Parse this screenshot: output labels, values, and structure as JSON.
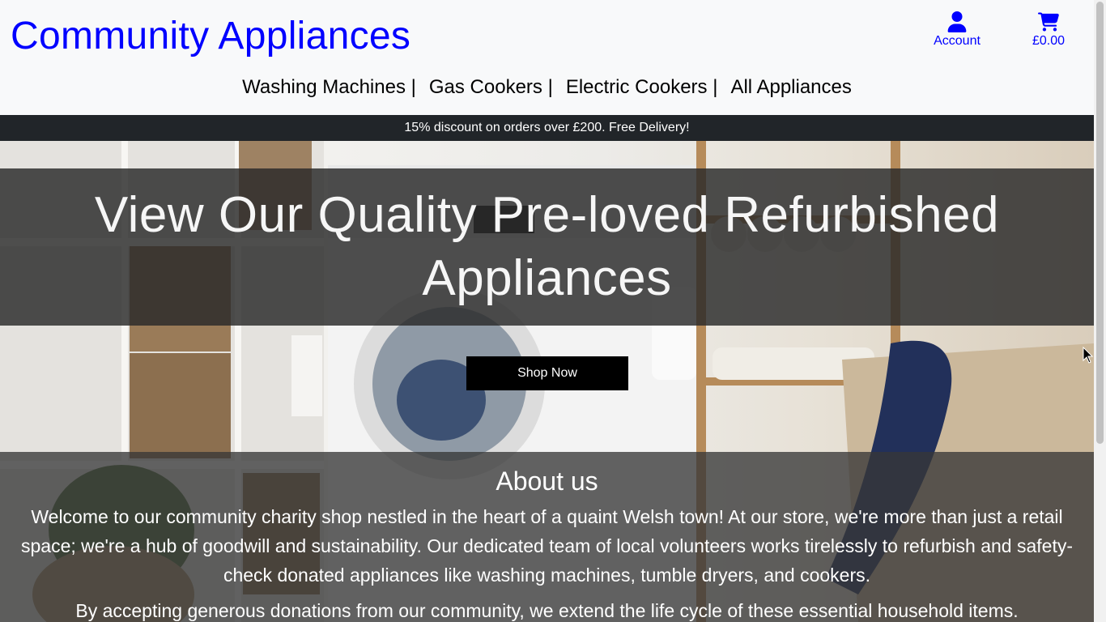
{
  "header": {
    "brand": "Community Appliances",
    "account_label": "Account",
    "cart_total": "£0.00"
  },
  "nav": {
    "items": [
      {
        "label": "Washing Machines |"
      },
      {
        "label": "Gas Cookers |"
      },
      {
        "label": "Electric Cookers |"
      },
      {
        "label": "All Appliances"
      }
    ]
  },
  "promo": {
    "text": "15% discount on orders over £200. Free Delivery!"
  },
  "hero": {
    "title": "View Our Quality Pre-loved Refurbished Appliances",
    "button_label": "Shop Now"
  },
  "about": {
    "heading": "About us",
    "paragraph_1": "Welcome to our community charity shop nestled in the heart of a quaint Welsh town! At our store, we're more than just a retail space; we're a hub of goodwill and sustainability. Our dedicated team of local volunteers works tirelessly to refurbish and safety-check donated appliances like washing machines, tumble dryers, and cookers.",
    "paragraph_2": "By accepting generous donations from our community, we extend the life cycle of these essential household items."
  },
  "colors": {
    "brand_blue": "#0000ff",
    "promo_bg": "#212529",
    "header_bg": "#f8f9fa"
  },
  "icons": {
    "account": "user-icon",
    "cart": "shopping-cart-icon"
  }
}
